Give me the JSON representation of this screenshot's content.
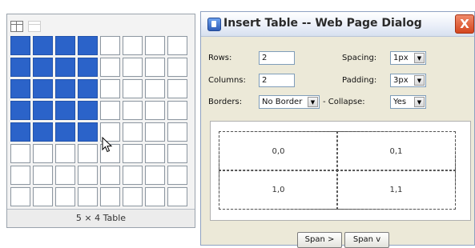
{
  "picker": {
    "footer": "5 × 4 Table",
    "columns": 8,
    "rows": 8,
    "selected_columns": 4,
    "selected_rows": 5
  },
  "dialog": {
    "title": "Insert Table -- Web Page Dialog",
    "close_label": "X",
    "rows_label": "Rows:",
    "rows_value": "2",
    "columns_label": "Columns:",
    "columns_value": "2",
    "spacing_label": "Spacing:",
    "spacing_value": "1px",
    "padding_label": "Padding:",
    "padding_value": "3px",
    "borders_label": "Borders:",
    "borders_value": "No Border",
    "collapse_label": "- Collapse:",
    "collapse_value": "Yes",
    "preview_cells": [
      "0,0",
      "0,1",
      "1,0",
      "1,1"
    ],
    "span_right_label": "Span >",
    "span_down_label": "Span v"
  },
  "colors": {
    "selected_cell": "#2b63c9",
    "dialog_bg": "#ece9d8",
    "close_button": "#d4461e"
  }
}
